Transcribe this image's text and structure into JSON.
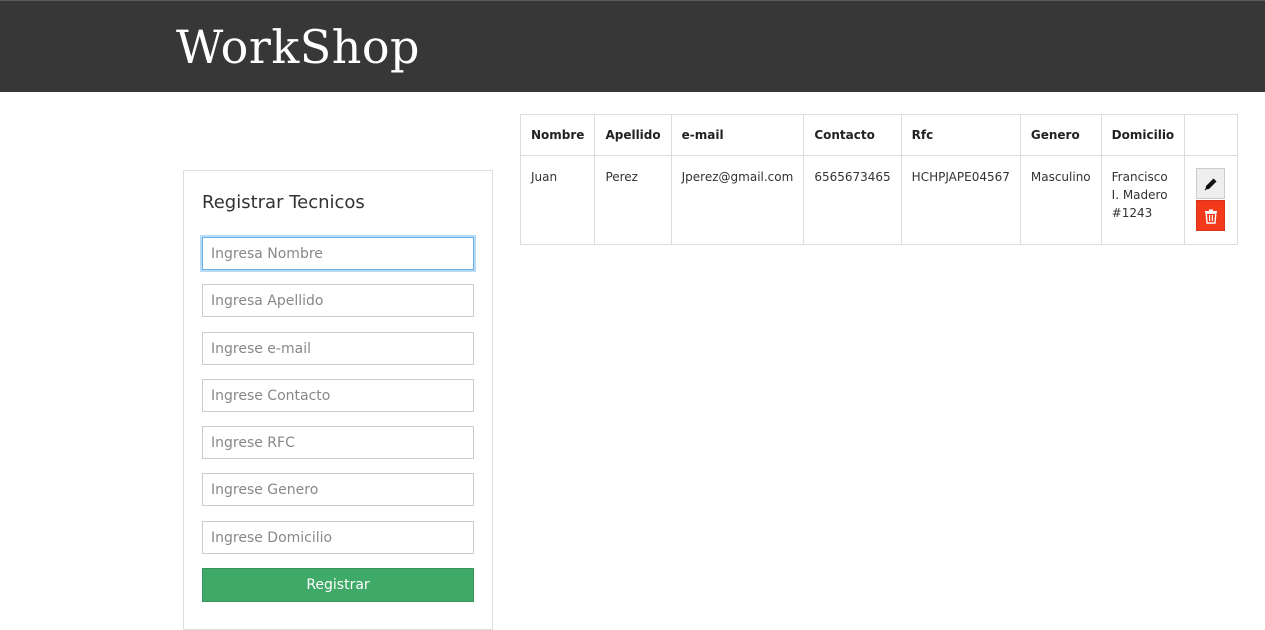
{
  "header": {
    "brand": "WorkShop"
  },
  "form": {
    "title": "Registrar Tecnicos",
    "fields": {
      "nombre": {
        "placeholder": "Ingresa Nombre",
        "value": ""
      },
      "apellido": {
        "placeholder": "Ingresa Apellido",
        "value": ""
      },
      "email": {
        "placeholder": "Ingrese e-mail",
        "value": ""
      },
      "contacto": {
        "placeholder": "Ingrese Contacto",
        "value": ""
      },
      "rfc": {
        "placeholder": "Ingrese RFC",
        "value": ""
      },
      "genero": {
        "placeholder": "Ingrese Genero",
        "value": ""
      },
      "domicilio": {
        "placeholder": "Ingrese Domicilio",
        "value": ""
      }
    },
    "submit_label": "Registrar",
    "submit_color": "#3fa967"
  },
  "table": {
    "columns": [
      "Nombre",
      "Apellido",
      "e-mail",
      "Contacto",
      "Rfc",
      "Genero",
      "Domicilio",
      ""
    ],
    "rows": [
      {
        "nombre": "Juan",
        "apellido": "Perez",
        "email": "Jperez@gmail.com",
        "contacto": "6565673465",
        "rfc": "HCHPJAPE04567",
        "genero": "Masculino",
        "domicilio": "Francisco I. Madero #1243",
        "actions": [
          {
            "name": "edit",
            "icon": "pencil-icon"
          },
          {
            "name": "delete",
            "icon": "trash-icon",
            "color": "#f23a1b"
          }
        ]
      }
    ]
  }
}
